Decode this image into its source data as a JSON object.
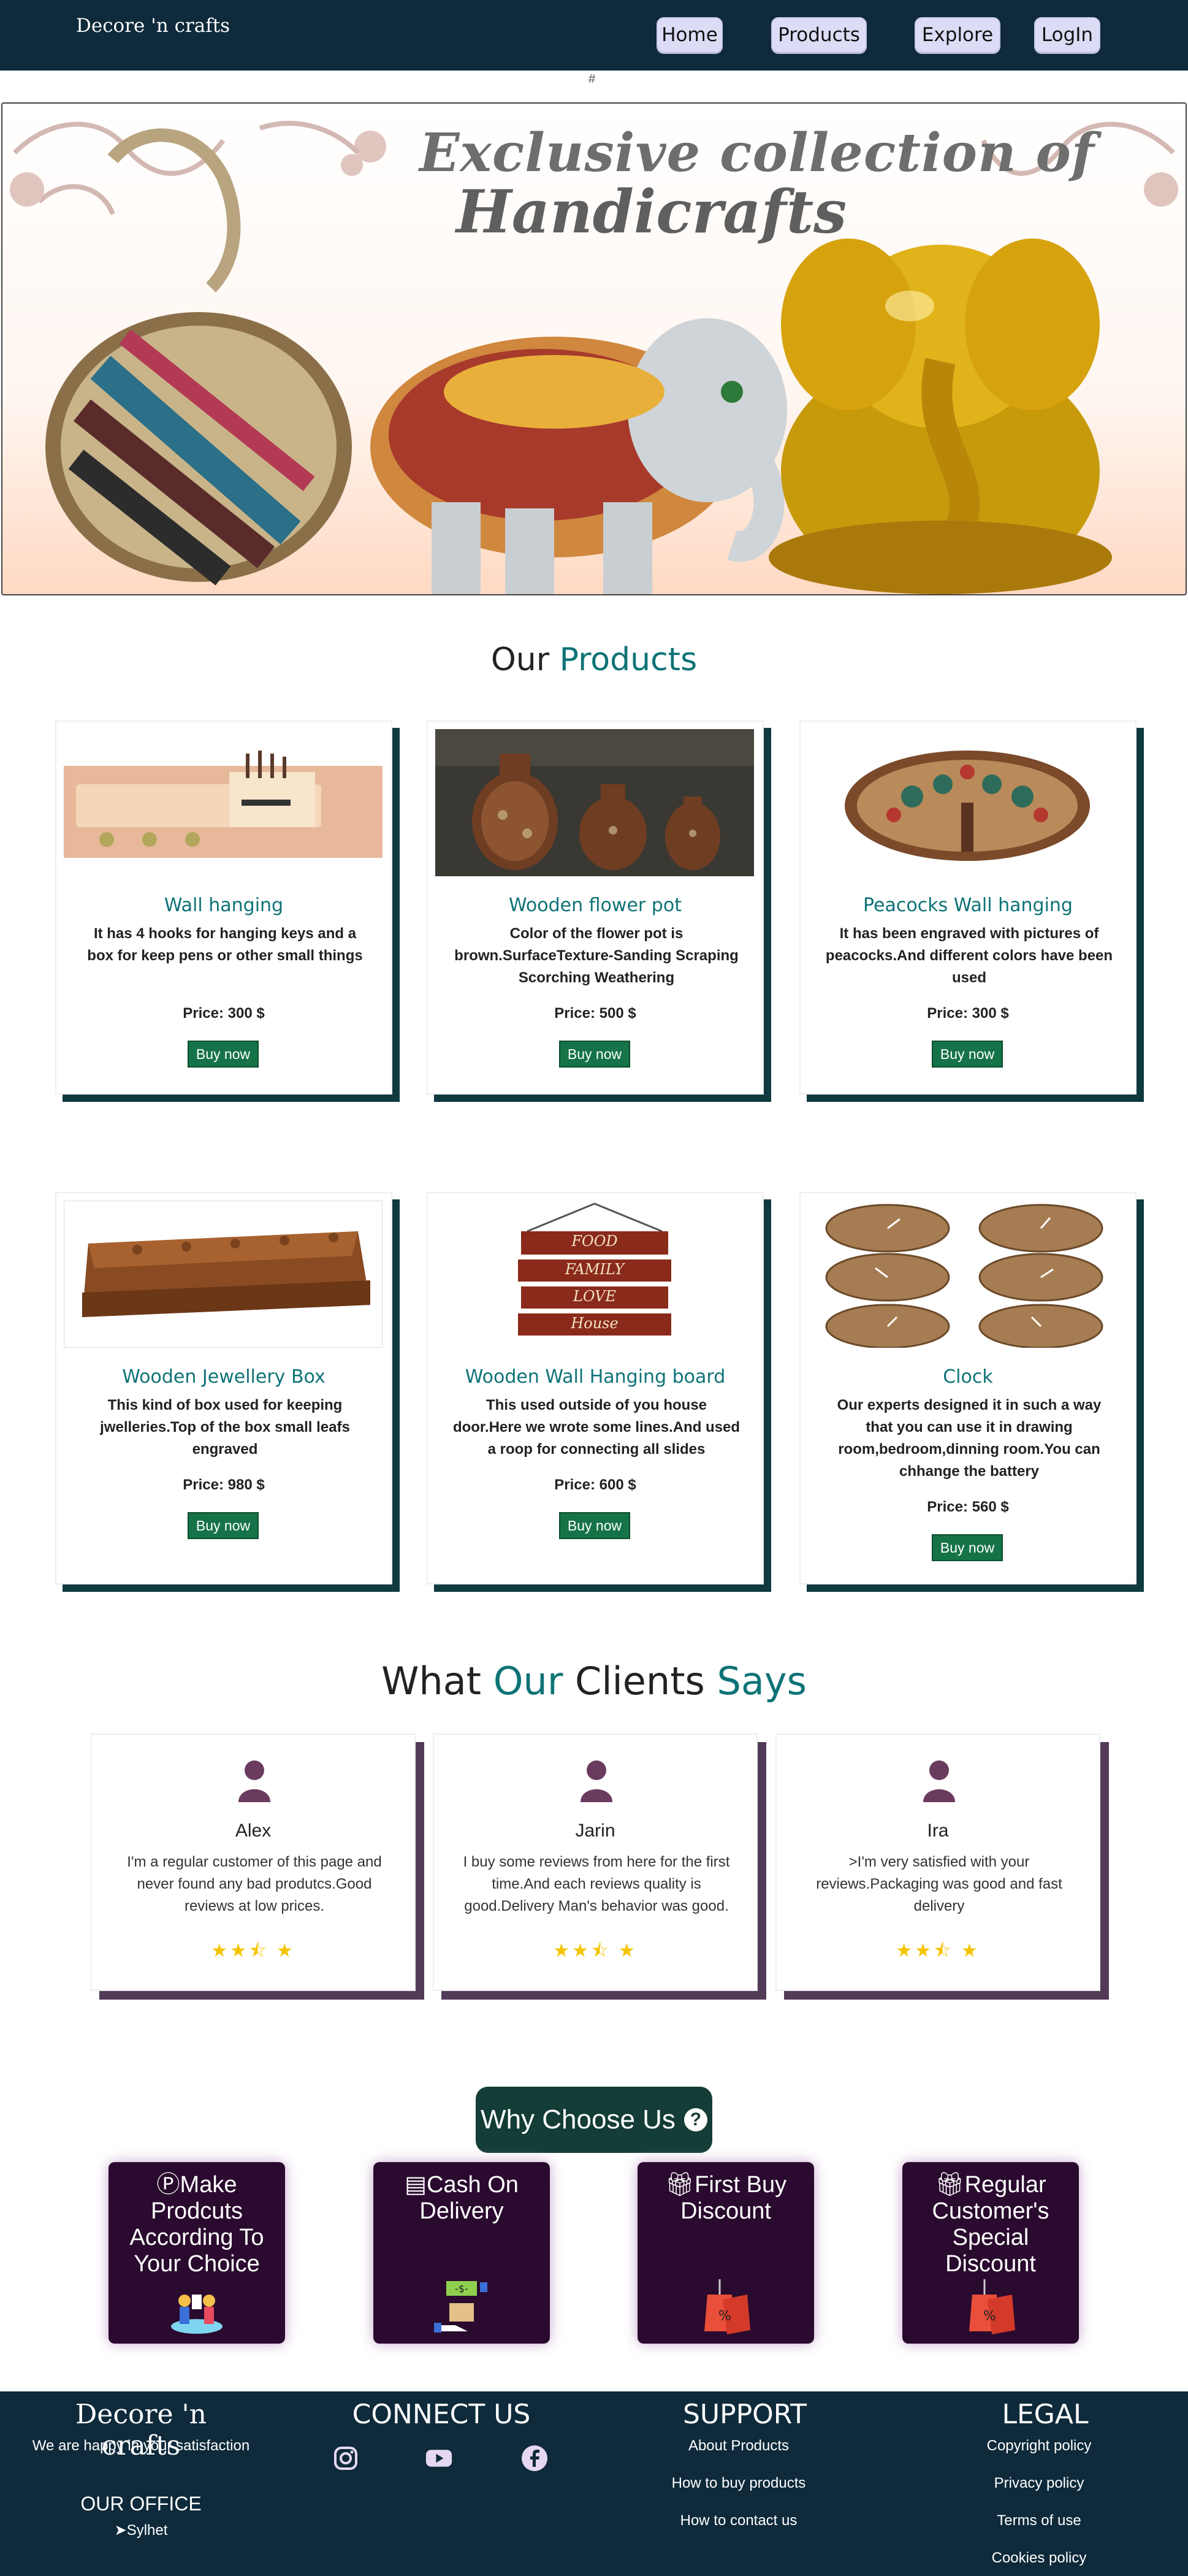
{
  "nav": {
    "brand": "Decore 'n crafts",
    "links": [
      "Home",
      "Products",
      "Explore",
      "LogIn"
    ]
  },
  "hash": "#",
  "banner": {
    "line1": "Exclusive collection of",
    "line2": "Handicrafts"
  },
  "products_section": {
    "title_part1": "Our",
    "title_part2": "Products"
  },
  "products": [
    {
      "title": "Wall hanging",
      "desc": "It has 4 hooks for hanging keys and a box for keep pens or other small things",
      "price": "Price: 300 $",
      "button": "Buy now"
    },
    {
      "title": "Wooden flower pot",
      "desc": "Color of the flower pot is brown.SurfaceTexture-Sanding Scraping Scorching Weathering",
      "price": "Price: 500 $",
      "button": "Buy now"
    },
    {
      "title": "Peacocks Wall hanging",
      "desc": "It has been engraved with pictures of peacocks.And different colors have been used",
      "price": "Price: 300 $",
      "button": "Buy now"
    },
    {
      "title": "Wooden Jewellery Box",
      "desc": "This kind of box used for keeping jwelleries.Top of the box small leafs engraved",
      "price": "Price: 980 $",
      "button": "Buy now"
    },
    {
      "title": "Wooden Wall Hanging board",
      "desc": "This used outside of you house door.Here we wrote some lines.And used a roop for connecting all slides",
      "price": "Price: 600 $",
      "button": "Buy now"
    },
    {
      "title": "Clock",
      "desc": "Our experts designed it in such a way that you can use it in drawing room,bedroom,dinning room.You can chhange the battery",
      "price": "Price: 560 $",
      "button": "Buy now"
    }
  ],
  "board_words": [
    "FOOD",
    "FAMILY",
    "LOVE",
    "House"
  ],
  "reviews_section": {
    "w1": "What",
    "w2": "Our",
    "w3": "Clients",
    "w4": "Says"
  },
  "reviews": [
    {
      "name": "Alex",
      "text": "I'm a regular customer of this page and never found any bad produtcs.Good reviews at low prices.",
      "rating": 2.5
    },
    {
      "name": "Jarin",
      "text": "I buy some reviews from here for the first time.And each reviews quality is good.Delivery Man's behavior was good.",
      "rating": 2.5
    },
    {
      "name": "Ira",
      "text": ">I'm very satisfied with your reviews.Packaging was good and fast delivery",
      "rating": 2.5
    }
  ],
  "why": {
    "title": "Why Choose Us",
    "items": [
      {
        "title": "Make Prodcuts According To Your Choice",
        "icon": "product-icon"
      },
      {
        "title": "Cash On Delivery",
        "icon": "money-card-icon"
      },
      {
        "title": "First Buy Discount",
        "icon": "gift-icon"
      },
      {
        "title": "Regular Customer's Special Discount",
        "icon": "gift-icon"
      }
    ]
  },
  "footer": {
    "brand": "Decore 'n crafts",
    "tagline": "We are happy in your satisfaction",
    "office_title": "OUR OFFICE",
    "office_city": "Sylhet",
    "connect_title": "CONNECT US",
    "support_title": "SUPPORT",
    "support_links": [
      "About Products",
      "How to buy products",
      "How to contact us"
    ],
    "legal_title": "LEGAL",
    "legal_links": [
      "Copyright policy",
      "Privacy policy",
      "Terms of use",
      "Cookies policy"
    ]
  },
  "colors": {
    "navbar": "#0e2a3b",
    "accent_teal": "#0e7377",
    "buy_green": "#157347",
    "review_shadow": "#533b58",
    "why_card": "#2a0a2e"
  }
}
